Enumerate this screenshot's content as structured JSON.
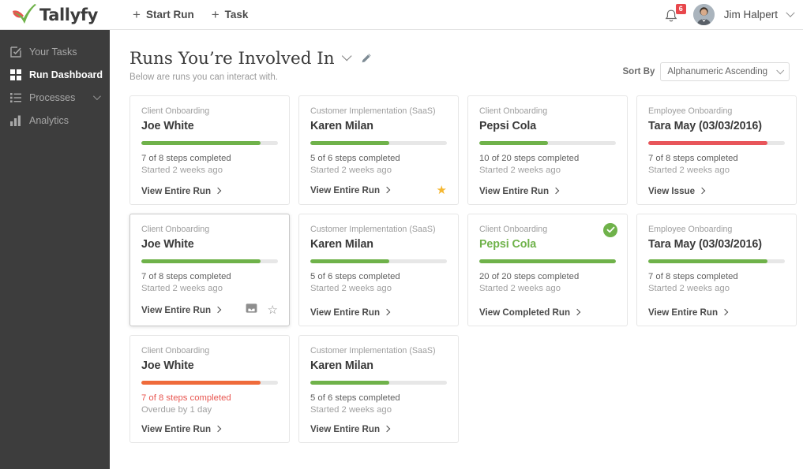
{
  "brand": {
    "name": "Tallyfy",
    "logo_icon": "check-swoosh-logo",
    "green": "#6fb24a",
    "red": "#e8555a",
    "orange": "#ef6b3b"
  },
  "topbar": {
    "nav": [
      {
        "label": "Start Run",
        "icon": "plus-icon",
        "name": "start-run"
      },
      {
        "label": "Task",
        "icon": "plus-icon",
        "name": "task"
      }
    ],
    "notifications": {
      "icon": "bell-icon",
      "count": "6"
    },
    "user": {
      "name": "Jim Halpert",
      "avatar_icon": "user-avatar",
      "caret_icon": "chevron-down-icon"
    }
  },
  "sidebar": {
    "items": [
      {
        "label": "Your Tasks",
        "icon": "checklist-icon",
        "active": false,
        "expandable": false
      },
      {
        "label": "Run Dashboard",
        "icon": "grid-icon",
        "active": true,
        "expandable": false
      },
      {
        "label": "Processes",
        "icon": "list-icon",
        "active": false,
        "expandable": true
      },
      {
        "label": "Analytics",
        "icon": "bar-chart-icon",
        "active": false,
        "expandable": false
      }
    ]
  },
  "header": {
    "title": "Runs You’re Involved In",
    "subtitle": "Below are runs you can interact with.",
    "dropdown_icon": "chevron-down-icon",
    "edit_icon": "pencil-icon"
  },
  "sort": {
    "label": "Sort By",
    "value": "Alphanumeric Ascending",
    "caret_icon": "chevron-down-icon"
  },
  "cards": [
    {
      "process": "Client Onboarding",
      "name": "Joe White",
      "steps": "7 of 8 steps completed",
      "time": "Started 2 weeks ago",
      "link": "View Entire Run",
      "progress_pct": 87,
      "bar_color": "#6fb24a",
      "steps_color": "#5f5f5f",
      "name_color": "#3a3a3a",
      "hovered": false,
      "completed": false,
      "star": "none",
      "bookmark": false
    },
    {
      "process": "Customer Implementation (SaaS)",
      "name": "Karen Milan",
      "steps": "5 of 6 steps completed",
      "time": "Started 2 weeks ago",
      "link": "View Entire Run",
      "progress_pct": 58,
      "bar_color": "#6fb24a",
      "steps_color": "#5f5f5f",
      "name_color": "#3a3a3a",
      "hovered": false,
      "completed": false,
      "star": "filled",
      "bookmark": false
    },
    {
      "process": "Client Onboarding",
      "name": "Pepsi Cola",
      "steps": "10 of 20 steps completed",
      "time": "Started 2 weeks ago",
      "link": "View Entire Run",
      "progress_pct": 50,
      "bar_color": "#6fb24a",
      "steps_color": "#5f5f5f",
      "name_color": "#3a3a3a",
      "hovered": false,
      "completed": false,
      "star": "none",
      "bookmark": false
    },
    {
      "process": "Employee Onboarding",
      "name": "Tara May (03/03/2016)",
      "steps": "7 of 8 steps completed",
      "time": "Started 2 weeks ago",
      "link": "View Issue",
      "progress_pct": 87,
      "bar_color": "#e8555a",
      "steps_color": "#5f5f5f",
      "name_color": "#3a3a3a",
      "hovered": false,
      "completed": false,
      "star": "none",
      "bookmark": false
    },
    {
      "process": "Client Onboarding",
      "name": "Joe White",
      "steps": "7 of 8 steps completed",
      "time": "Started 2 weeks ago",
      "link": "View Entire Run",
      "progress_pct": 87,
      "bar_color": "#6fb24a",
      "steps_color": "#5f5f5f",
      "name_color": "#3a3a3a",
      "hovered": true,
      "completed": false,
      "star": "outline",
      "bookmark": true
    },
    {
      "process": "Customer Implementation (SaaS)",
      "name": "Karen Milan",
      "steps": "5 of 6 steps completed",
      "time": "Started 2 weeks ago",
      "link": "View Entire Run",
      "progress_pct": 58,
      "bar_color": "#6fb24a",
      "steps_color": "#5f5f5f",
      "name_color": "#3a3a3a",
      "hovered": false,
      "completed": false,
      "star": "none",
      "bookmark": false
    },
    {
      "process": "Client Onboarding",
      "name": "Pepsi Cola",
      "steps": "20 of 20 steps completed",
      "time": "Started 2 weeks ago",
      "link": "View Completed Run",
      "progress_pct": 100,
      "bar_color": "#6fb24a",
      "steps_color": "#5f5f5f",
      "name_color": "#6fb24a",
      "hovered": false,
      "completed": true,
      "star": "none",
      "bookmark": false
    },
    {
      "process": "Employee Onboarding",
      "name": "Tara May (03/03/2016)",
      "steps": "7 of 8 steps completed",
      "time": "Started 2 weeks ago",
      "link": "View Entire Run",
      "progress_pct": 87,
      "bar_color": "#6fb24a",
      "steps_color": "#5f5f5f",
      "name_color": "#3a3a3a",
      "hovered": false,
      "completed": false,
      "star": "none",
      "bookmark": false
    },
    {
      "process": "Client Onboarding",
      "name": "Joe White",
      "steps": "7 of 8 steps completed",
      "time": "Overdue by 1 day",
      "link": "View Entire Run",
      "progress_pct": 87,
      "bar_color": "#ef6b3b",
      "steps_color": "#e8554f",
      "name_color": "#3a3a3a",
      "hovered": false,
      "completed": false,
      "star": "none",
      "bookmark": false
    },
    {
      "process": "Customer Implementation (SaaS)",
      "name": "Karen Milan",
      "steps": "5 of 6 steps completed",
      "time": "Started 2 weeks ago",
      "link": "View Entire Run",
      "progress_pct": 58,
      "bar_color": "#6fb24a",
      "steps_color": "#5f5f5f",
      "name_color": "#3a3a3a",
      "hovered": false,
      "completed": false,
      "star": "none",
      "bookmark": false
    }
  ]
}
